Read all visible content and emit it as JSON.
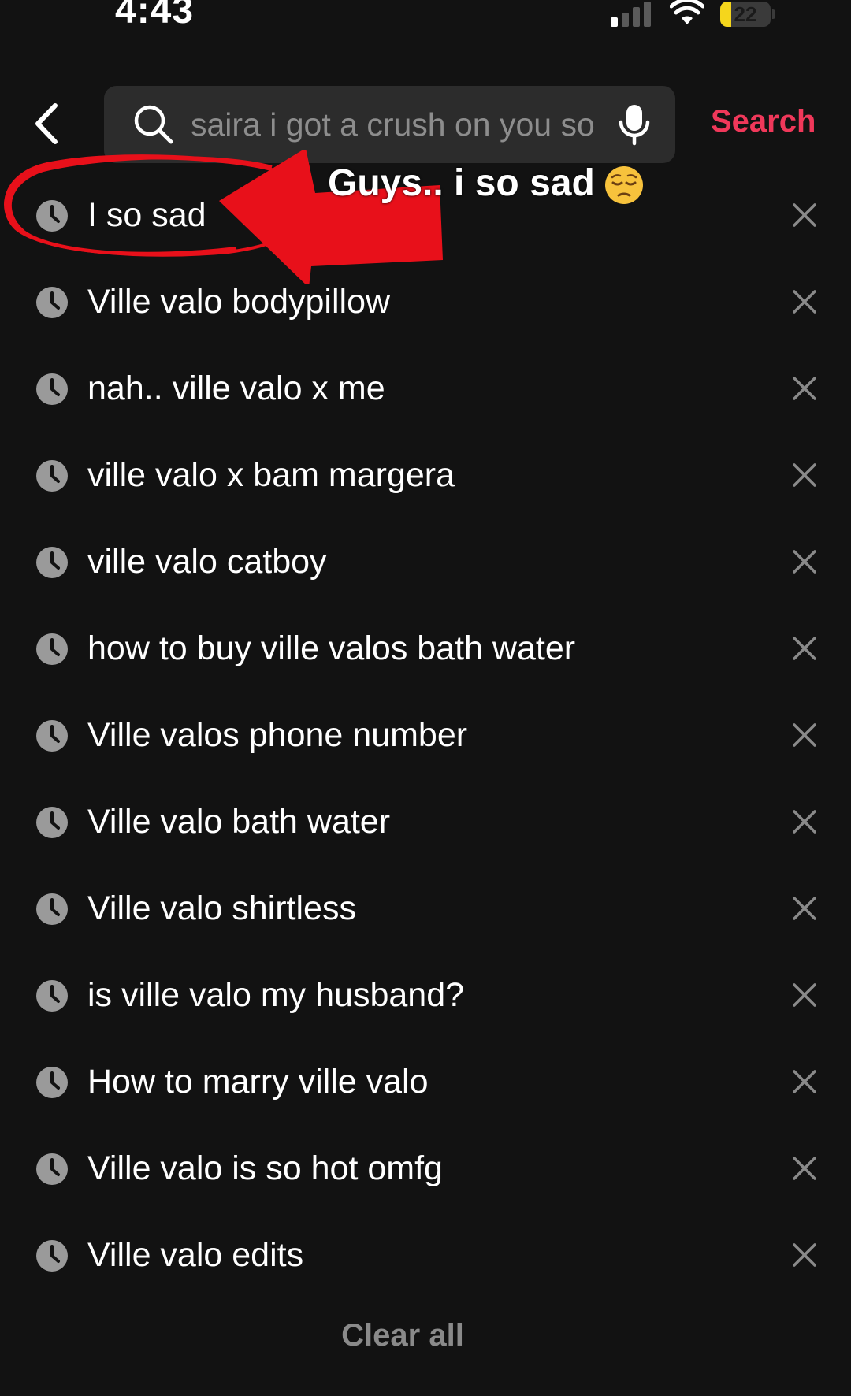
{
  "status_bar": {
    "time": "4:43",
    "battery_level": "22",
    "battery_fraction": 0.22,
    "signal_icon": "cellular-signal-icon",
    "wifi_icon": "wifi-icon"
  },
  "header": {
    "back_icon": "chevron-left-icon",
    "search_icon": "search-icon",
    "search_value": "saira i got a crush on you so",
    "mic_icon": "microphone-icon",
    "search_button_label": "Search"
  },
  "history": {
    "items": [
      {
        "label": "I so sad"
      },
      {
        "label": "Ville valo bodypillow"
      },
      {
        "label": "nah.. ville valo x me"
      },
      {
        "label": "ville valo x bam margera"
      },
      {
        "label": "ville valo catboy"
      },
      {
        "label": "how to buy ville valos bath water"
      },
      {
        "label": "Ville valos phone number"
      },
      {
        "label": "Ville valo bath water"
      },
      {
        "label": "Ville valo shirtless"
      },
      {
        "label": "is ville valo my husband?"
      },
      {
        "label": "How to marry ville valo"
      },
      {
        "label": "Ville valo is so hot omfg"
      },
      {
        "label": "Ville valo edits"
      }
    ],
    "item_icon": "clock-icon",
    "remove_icon": "close-icon",
    "clear_all_label": "Clear all"
  },
  "overlay": {
    "caption": "Guys.. i so sad",
    "emoji": "pensive-face-emoji",
    "arrow": "red-arrow",
    "circle": "red-scribble-circle"
  },
  "colors": {
    "background": "#121212",
    "search_field": "#2c2c2c",
    "accent": "#f0385a",
    "muted_text": "#8a8a8a",
    "annotation_red": "#e8101a"
  }
}
